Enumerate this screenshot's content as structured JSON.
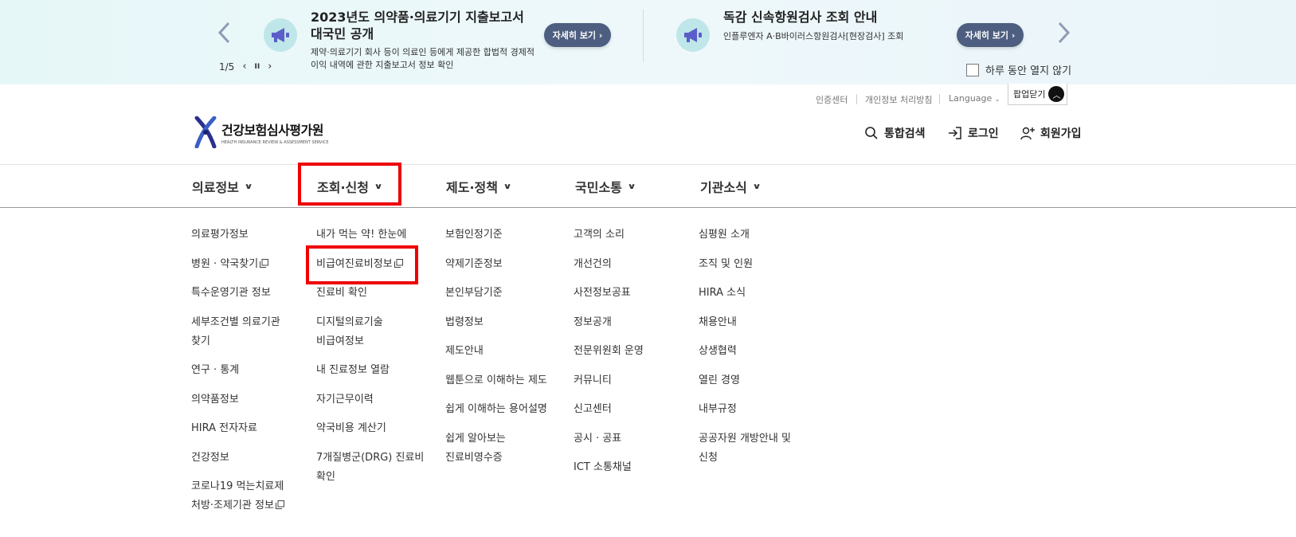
{
  "popup": {
    "slide1": {
      "title_line1": "2023년도 의약품·의료기기 지출보고서",
      "title_line2": "대국민 공개",
      "desc_line1": "제약·의료기기 회사 등이 의료인 등에게 제공한 합법적 경제적",
      "desc_line2": "이익 내역에 관한 지출보고서 정보 확인",
      "more_label": "자세히 보기 ›"
    },
    "slide2": {
      "title": "독감 신속항원검사 조회 안내",
      "desc": "인플루엔자 A·B바이러스항원검사[현장검사] 조회",
      "more_label": "자세히 보기 ›"
    },
    "pager": {
      "current_total": "1/5",
      "prev": "‹",
      "pause": "II",
      "next": "›"
    },
    "no_show_today": "하루 동안 열지 않기"
  },
  "utility": {
    "auth_center": "인증센터",
    "privacy_policy": "개인정보 처리방침",
    "language": "Language",
    "close_popup": "팝업닫기"
  },
  "header": {
    "logo_main": "건강보험심사평가원",
    "logo_sub": "HEALTH INSURANCE REVIEW & ASSESSMENT SERVICE",
    "search": "통합검색",
    "login": "로그인",
    "signup": "회원가입"
  },
  "gnb": [
    {
      "label": "의료정보",
      "items": [
        "의료평가정보",
        "병원 · 약국찾기",
        "특수운영기관 정보",
        "세부조건별 의료기관",
        "찾기",
        "연구 · 통계",
        "의약품정보",
        "HIRA 전자자료",
        "건강정보",
        "코로나19 먹는치료제",
        "처방·조제기관 정보"
      ]
    },
    {
      "label": "조회·신청",
      "items": [
        "내가 먹는 약! 한눈에",
        "비급여진료비정보",
        "진료비 확인",
        "디지털의료기술",
        "비급여정보",
        "내 진료정보 열람",
        "자기근무이력",
        "약국비용 계산기",
        "7개질병군(DRG) 진료비",
        "확인"
      ]
    },
    {
      "label": "제도·정책",
      "items": [
        "보험인정기준",
        "약제기준정보",
        "본인부담기준",
        "법령정보",
        "제도안내",
        "웹툰으로 이해하는 제도",
        "쉽게 이해하는 용어설명",
        "쉽게 알아보는",
        "진료비영수증"
      ]
    },
    {
      "label": "국민소통",
      "items": [
        "고객의 소리",
        "개선건의",
        "사전정보공표",
        "정보공개",
        "전문위원회 운영",
        "커뮤니티",
        "신고센터",
        "공시 · 공표",
        "ICT 소통채널"
      ]
    },
    {
      "label": "기관소식",
      "items": [
        "심평원 소개",
        "조직 및 인원",
        "HIRA 소식",
        "채용안내",
        "상생협력",
        "열린 경영",
        "내부규정",
        "공공자원 개방안내 및",
        "신청"
      ]
    }
  ],
  "colors": {
    "highlight": "#ee0000",
    "button": "#4d5e80"
  }
}
